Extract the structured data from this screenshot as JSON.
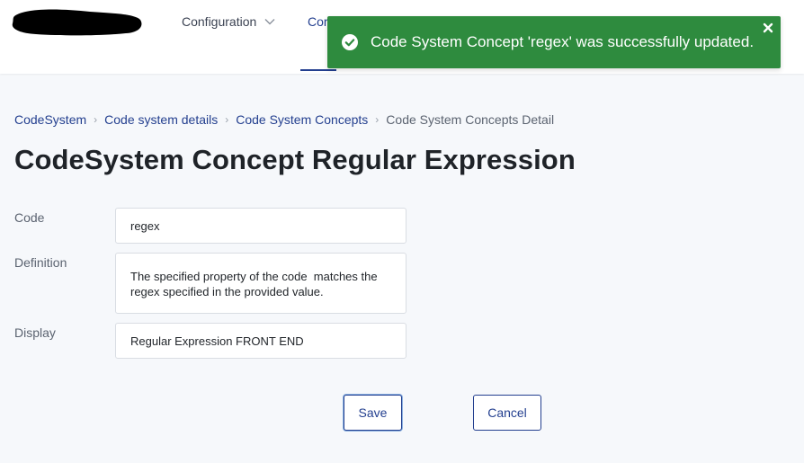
{
  "nav": {
    "items": [
      {
        "label": "Configuration"
      },
      {
        "label": "Cor"
      }
    ]
  },
  "toast": {
    "message": "Code System Concept 'regex' was successfully updated."
  },
  "breadcrumb": [
    {
      "label": "CodeSystem"
    },
    {
      "label": "Code system details"
    },
    {
      "label": "Code System Concepts"
    },
    {
      "label": "Code System Concepts Detail"
    }
  ],
  "page": {
    "title": "CodeSystem Concept Regular Expression"
  },
  "form": {
    "code": {
      "label": "Code",
      "value": "regex"
    },
    "definition": {
      "label": "Definition",
      "value": "The specified property of the code  matches the regex specified in the provided value."
    },
    "display": {
      "label": "Display",
      "value": "Regular Expression FRONT END"
    }
  },
  "actions": {
    "save_label": "Save",
    "cancel_label": "Cancel"
  },
  "colors": {
    "brand": "#233f8f",
    "success": "#2e8b3e",
    "background": "#f6f8fb"
  },
  "icons": {
    "toast_check": "check-circle-icon",
    "toast_close": "close-icon",
    "nav_chevron": "chevron-down-icon",
    "breadcrumb_sep": "chevron-right-icon"
  }
}
